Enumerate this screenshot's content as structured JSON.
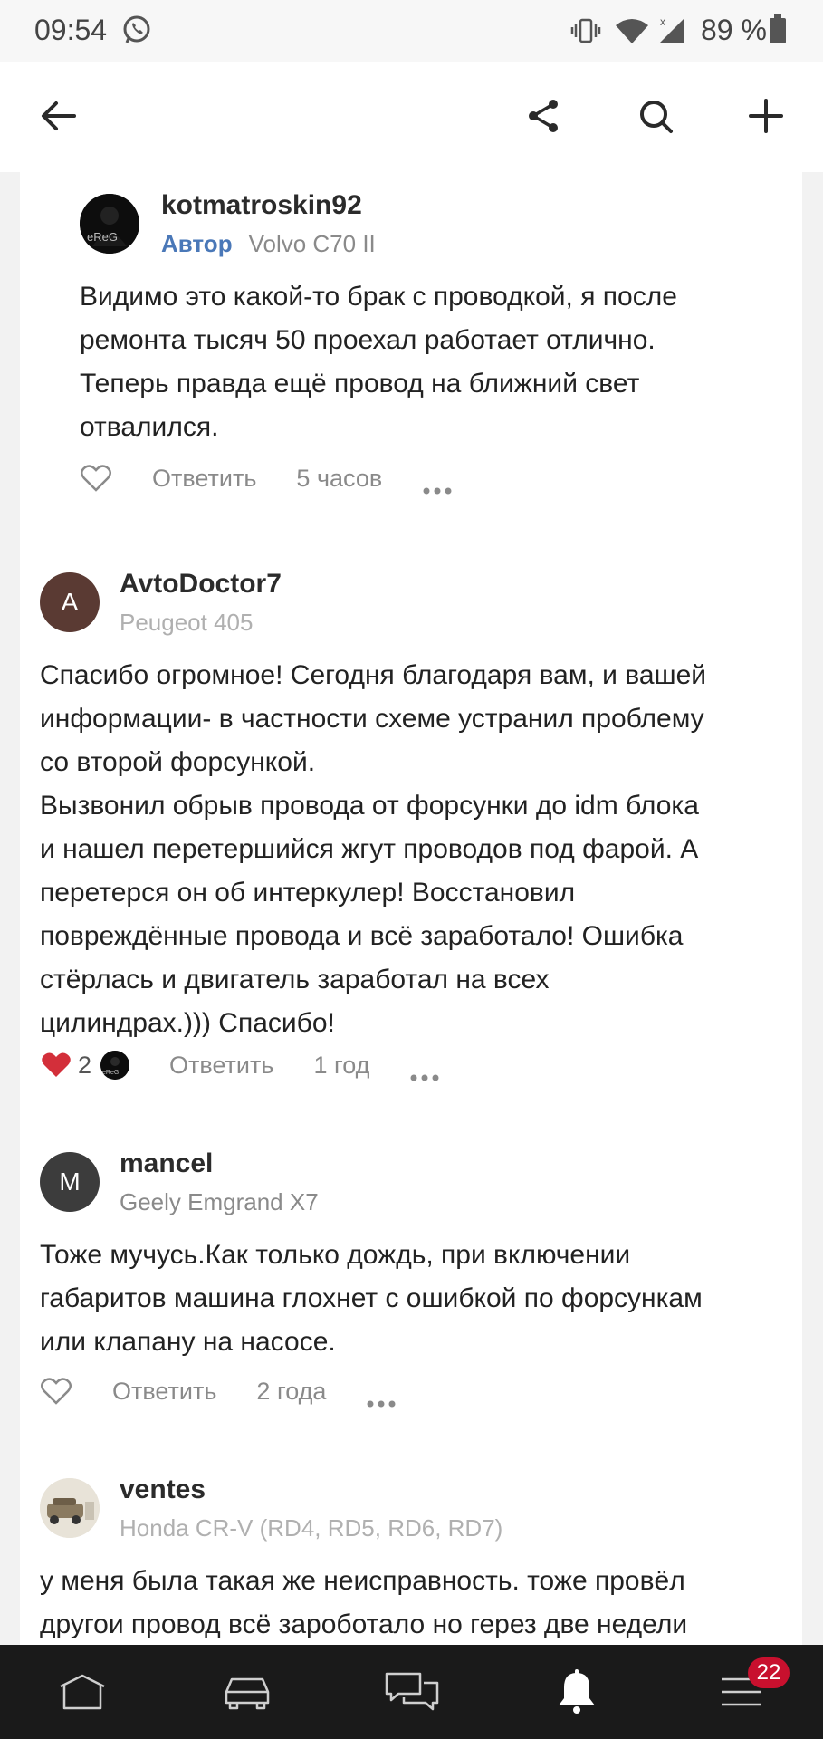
{
  "status_bar": {
    "time": "09:54",
    "battery": "89 %",
    "icons": [
      "whatsapp-icon",
      "vibrate-icon",
      "wifi-icon",
      "signal-icon",
      "battery-icon"
    ]
  },
  "top_bar": {
    "icons": [
      "back-arrow-icon",
      "share-icon",
      "search-icon",
      "plus-icon"
    ]
  },
  "comments": [
    {
      "username": "kotmatroskin92",
      "author_tag": "Автор",
      "car": "Volvo C70 II",
      "avatar_text": "",
      "text_lines": [
        "Видимо это какой-то брак с проводкой, я после",
        "ремонта тысяч 50 проехал работает отлично.",
        "Теперь правда ещё провод на ближний свет",
        "отвалился."
      ],
      "liked": false,
      "reply_label": "Ответить",
      "time": "5 часов"
    },
    {
      "username": "AvtoDoctor7",
      "car": "Peugeot 405",
      "avatar_text": "A",
      "text_lines": [
        "Спасибо огромное! Сегодня благодаря вам, и вашей",
        "информации- в частности схеме устранил проблему",
        "со второй форсункой.",
        "Вызвонил обрыв провода от форсунки до idm блока",
        "и нашел перетершийся жгут проводов под фарой. А",
        "перетерся он об интеркулер! Восстановил",
        "повреждённые провода и всё заработало! Ошибка",
        "стёрлась и двигатель заработал на всех",
        "цилиндрах.))) Спасибо!"
      ],
      "liked": true,
      "like_count": "2",
      "reply_label": "Ответить",
      "time": "1 год"
    },
    {
      "username": "mancel",
      "car": "Geely Emgrand X7",
      "avatar_text": "M",
      "text_lines": [
        "Тоже мучусь.Как только дождь, при включении",
        "габаритов машина глохнет с ошибкой по форсункам",
        "или клапану на насосе."
      ],
      "liked": false,
      "reply_label": "Ответить",
      "time": "2 года"
    },
    {
      "username": "ventes",
      "car": "Honda CR-V (RD4, RD5, RD6, RD7)",
      "avatar_text": "",
      "text_lines": [
        "у меня была такая же неисправность. тоже провёл",
        "другои провод всё зароботало но герез две недели"
      ]
    }
  ],
  "bottom_nav": {
    "items": [
      "home-icon",
      "garage-car-icon",
      "chat-icon",
      "notifications-bell-icon",
      "menu-icon"
    ],
    "menu_badge": "22"
  },
  "colors": {
    "author_tag": "#4a78b8",
    "like_red": "#d32f3a",
    "badge": "#c8102e",
    "bottom_bar": "#1a1a1a"
  }
}
